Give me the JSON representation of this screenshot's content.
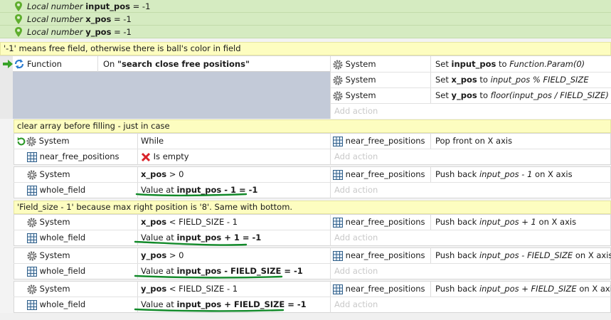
{
  "variables": [
    {
      "prefix": "Local number",
      "name": "input_pos",
      "suffix": " = -1"
    },
    {
      "prefix": "Local number",
      "name": "x_pos",
      "suffix": " = -1"
    },
    {
      "prefix": "Local number",
      "name": "y_pos",
      "suffix": " = -1"
    }
  ],
  "comments": {
    "c1": "'-1' means free field, otherwise there is ball's color in field",
    "c2": "clear array before filling - just in case",
    "c3": "'Field_size - 1' because max right position is '8'. Same with bottom."
  },
  "function_event": {
    "label": "Function",
    "on_prefix": "On ",
    "on_name": "\"search close free positions\"",
    "actions": [
      {
        "object": "System",
        "t1": "Set ",
        "b1": "input_pos",
        "t2": " to ",
        "i1": "Function.Param(0)"
      },
      {
        "object": "System",
        "t1": "Set ",
        "b1": "x_pos",
        "t2": " to ",
        "i1": "input_pos % FIELD_SIZE"
      },
      {
        "object": "System",
        "t1": "Set ",
        "b1": "y_pos",
        "t2": " to ",
        "i1": "floor(input_pos / FIELD_SIZE)"
      }
    ],
    "add_action": "Add action"
  },
  "while_event": {
    "cond1_object": "System",
    "cond1_text": "While",
    "cond2_object": "near_free_positions",
    "cond2_text": "Is empty",
    "action_object": "near_free_positions",
    "action_text": "Pop front on X axis",
    "add_action": "Add action"
  },
  "push_events": [
    {
      "c1_object": "System",
      "c1_bold": "x_pos",
      "c1_rest": " > 0",
      "c2_object": "whole_field",
      "c2_pre": "Value at ",
      "c2_bold": "input_pos - 1 = -1",
      "a_object": "near_free_positions",
      "a_pre": "Push back ",
      "a_italic": "input_pos - 1",
      "a_post": "  on X axis",
      "add_action": "Add action"
    },
    {
      "c1_object": "System",
      "c1_bold": "x_pos",
      "c1_rest": " < FIELD_SIZE - 1",
      "c2_object": "whole_field",
      "c2_pre": "Value at ",
      "c2_bold": "input_pos + 1 = -1",
      "a_object": "near_free_positions",
      "a_pre": "Push back ",
      "a_italic": "input_pos + 1",
      "a_post": "  on X axis",
      "add_action": "Add action"
    },
    {
      "c1_object": "System",
      "c1_bold": "y_pos",
      "c1_rest": " > 0",
      "c2_object": "whole_field",
      "c2_pre": "Value at ",
      "c2_bold": "input_pos - FIELD_SIZE = -1",
      "a_object": "near_free_positions",
      "a_pre": "Push back ",
      "a_italic": "input_pos - FIELD_SIZE",
      "a_post": "  on X axis",
      "add_action": "Add action"
    },
    {
      "c1_object": "System",
      "c1_bold": "y_pos",
      "c1_rest": " < FIELD_SIZE - 1",
      "c2_object": "whole_field",
      "c2_pre": "Value at ",
      "c2_bold": "input_pos + FIELD_SIZE = -1",
      "a_object": "near_free_positions",
      "a_pre": "Push back ",
      "a_italic": "input_pos + FIELD_SIZE",
      "a_post": "  on X axis",
      "add_action": "Add action"
    }
  ],
  "colors": {
    "variable_bg": "#d5ebc1",
    "comment_bg": "#fdfdc0",
    "selected_event_bg": "#c3cad8",
    "underline": "#128a2a"
  },
  "icons": [
    "pin-icon",
    "gear-icon",
    "grid-icon",
    "function-icon",
    "loop-icon",
    "red-x-icon",
    "green-arrow-icon"
  ]
}
